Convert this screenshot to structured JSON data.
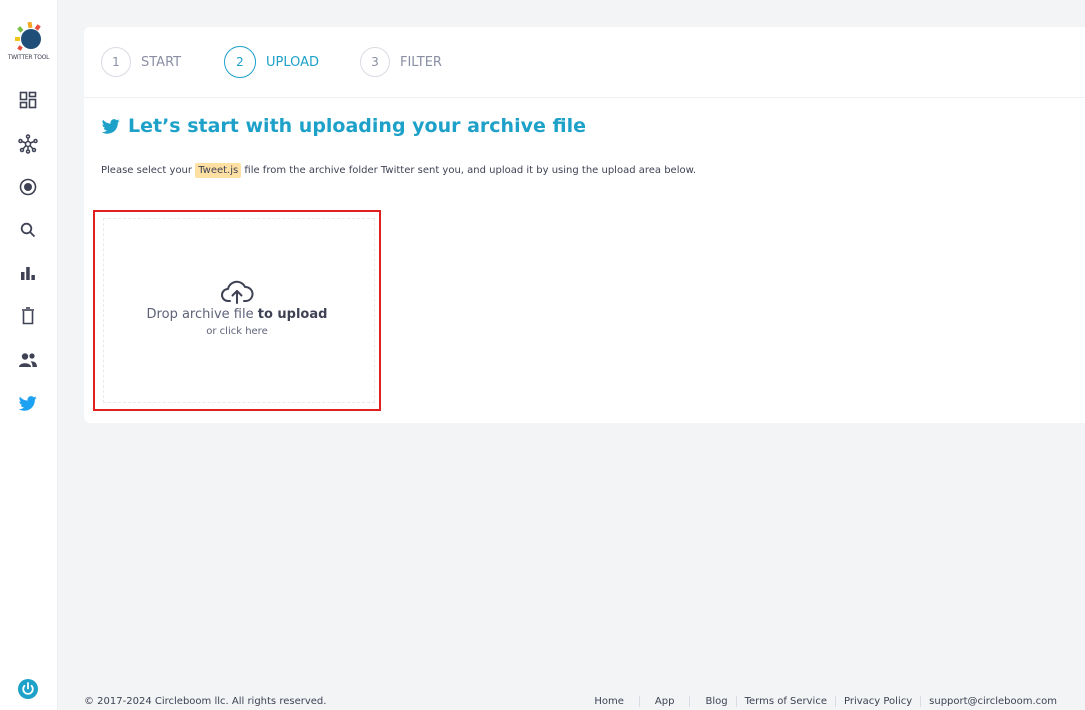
{
  "logo": {
    "text": "TWITTER TOOL"
  },
  "sidebar": {
    "items": [
      {
        "icon": "dashboard-icon"
      },
      {
        "icon": "network-icon"
      },
      {
        "icon": "record-icon"
      },
      {
        "icon": "search-icon"
      },
      {
        "icon": "bar-chart-icon"
      },
      {
        "icon": "trash-icon"
      },
      {
        "icon": "users-icon"
      },
      {
        "icon": "twitter-bird-icon"
      }
    ],
    "power_icon": "power-icon"
  },
  "steps": [
    {
      "number": "1",
      "label": "START"
    },
    {
      "number": "2",
      "label": "UPLOAD",
      "active": true
    },
    {
      "number": "3",
      "label": "FILTER"
    }
  ],
  "main": {
    "heading": "Let’s start with uploading your archive file",
    "desc_before": "Please select your ",
    "desc_highlight": "Tweet.js",
    "desc_after": " file from the archive folder Twitter sent you, and upload it by using the upload area below."
  },
  "upload": {
    "title_normal": "Drop archive file ",
    "title_bold": "to upload",
    "subtitle": "or click here"
  },
  "footer": {
    "copyright": "© 2017-2024 Circleboom llc. All rights reserved.",
    "links": [
      "Home",
      "App",
      "Blog",
      "Terms of Service",
      "Privacy Policy",
      "support@circleboom.com"
    ]
  },
  "colors": {
    "accent": "#1da1c9",
    "highlight": "#ffe0a3",
    "dropzone_border": "#e02020",
    "twitter_blue": "#1da1f2"
  }
}
